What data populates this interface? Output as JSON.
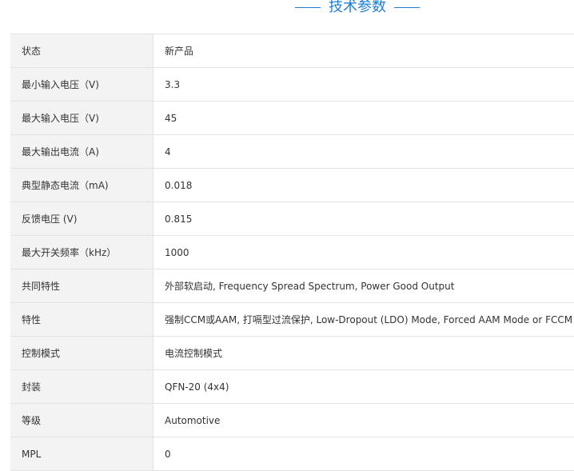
{
  "section": {
    "title": "技术参数"
  },
  "params": [
    {
      "label": "状态",
      "value": "新产品"
    },
    {
      "label": "最小输入电压（V)",
      "value": "3.3"
    },
    {
      "label": "最大输入电压（V)",
      "value": "45"
    },
    {
      "label": "最大输出电流（A)",
      "value": "4"
    },
    {
      "label": "典型静态电流（mA)",
      "value": "0.018"
    },
    {
      "label": "反馈电压 (V)",
      "value": "0.815"
    },
    {
      "label": "最大开关频率（kHz）",
      "value": "1000"
    },
    {
      "label": "共同特性",
      "value": "外部软启动, Frequency Spread Spectrum, Power Good Output"
    },
    {
      "label": "特性",
      "value": "强制CCM或AAM, 打嗝型过流保护, Low-Dropout (LDO) Mode, Forced AAM Mode or FCCM"
    },
    {
      "label": "控制模式",
      "value": "电流控制模式"
    },
    {
      "label": "封装",
      "value": "QFN-20 (4x4)"
    },
    {
      "label": "等级",
      "value": "Automotive"
    },
    {
      "label": "MPL",
      "value": "0"
    }
  ]
}
